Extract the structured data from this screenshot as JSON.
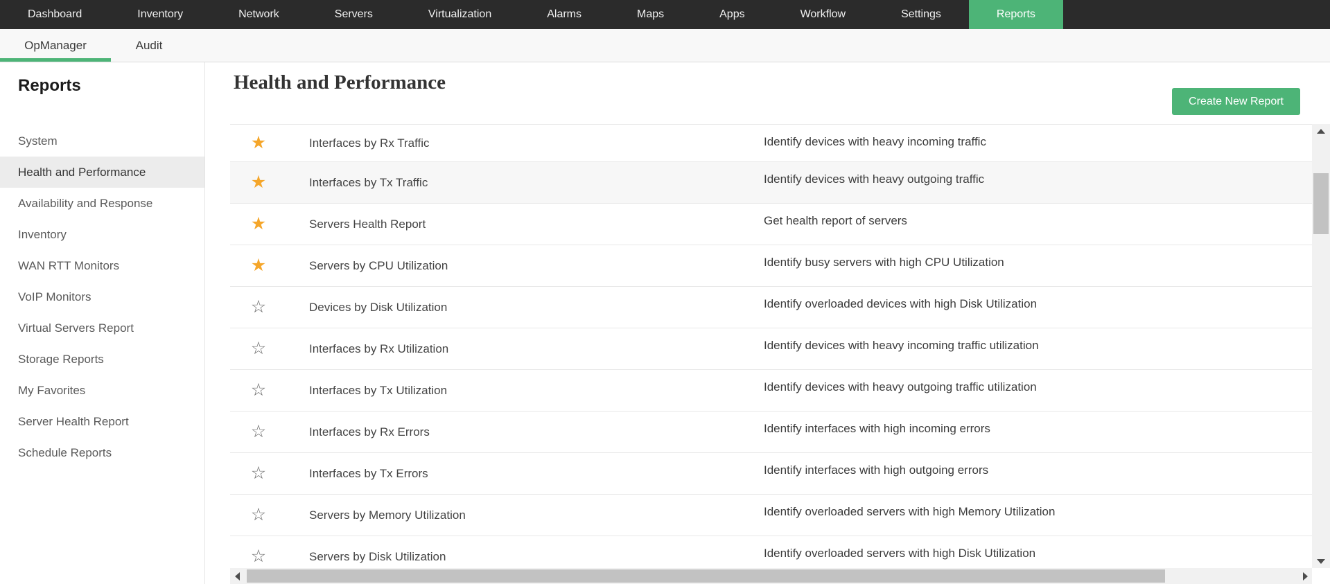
{
  "colors": {
    "accent_green": "#4db477",
    "nav_background": "#2b2b2b",
    "star_orange": "#f5a62a",
    "active_sidebar_bg": "#ececec"
  },
  "topnav": {
    "items": [
      {
        "label": "Dashboard",
        "active": false
      },
      {
        "label": "Inventory",
        "active": false
      },
      {
        "label": "Network",
        "active": false
      },
      {
        "label": "Servers",
        "active": false
      },
      {
        "label": "Virtualization",
        "active": false
      },
      {
        "label": "Alarms",
        "active": false
      },
      {
        "label": "Maps",
        "active": false
      },
      {
        "label": "Apps",
        "active": false
      },
      {
        "label": "Workflow",
        "active": false
      },
      {
        "label": "Settings",
        "active": false
      },
      {
        "label": "Reports",
        "active": true
      }
    ]
  },
  "subnav": {
    "tabs": [
      {
        "label": "OpManager",
        "active": true
      },
      {
        "label": "Audit",
        "active": false
      }
    ]
  },
  "sidebar": {
    "title": "Reports",
    "items": [
      {
        "label": "System",
        "active": false
      },
      {
        "label": "Health and Performance",
        "active": true
      },
      {
        "label": "Availability and Response",
        "active": false
      },
      {
        "label": "Inventory",
        "active": false
      },
      {
        "label": "WAN RTT Monitors",
        "active": false
      },
      {
        "label": "VoIP Monitors",
        "active": false
      },
      {
        "label": "Virtual Servers Report",
        "active": false
      },
      {
        "label": "Storage Reports",
        "active": false
      },
      {
        "label": "My Favorites",
        "active": false
      },
      {
        "label": "Server Health Report",
        "active": false
      },
      {
        "label": "Schedule Reports",
        "active": false
      }
    ]
  },
  "main": {
    "title": "Health and Performance",
    "create_button_label": "Create New Report",
    "hovered_row_index": 1,
    "reports": [
      {
        "starred": true,
        "name": "Interfaces by Rx Traffic",
        "description": "Identify devices with heavy incoming traffic"
      },
      {
        "starred": true,
        "name": "Interfaces by Tx Traffic",
        "description": "Identify devices with heavy outgoing traffic"
      },
      {
        "starred": true,
        "name": "Servers Health Report",
        "description": "Get health report of servers"
      },
      {
        "starred": true,
        "name": "Servers by CPU Utilization",
        "description": "Identify busy servers with high CPU Utilization"
      },
      {
        "starred": false,
        "name": "Devices by Disk Utilization",
        "description": "Identify overloaded devices with high Disk Utilization"
      },
      {
        "starred": false,
        "name": "Interfaces by Rx Utilization",
        "description": "Identify devices with heavy incoming traffic utilization"
      },
      {
        "starred": false,
        "name": "Interfaces by Tx Utilization",
        "description": "Identify devices with heavy outgoing traffic utilization"
      },
      {
        "starred": false,
        "name": "Interfaces by Rx Errors",
        "description": "Identify interfaces with high incoming errors"
      },
      {
        "starred": false,
        "name": "Interfaces by Tx Errors",
        "description": "Identify interfaces with high outgoing errors"
      },
      {
        "starred": false,
        "name": "Servers by Memory Utilization",
        "description": "Identify overloaded servers with high Memory Utilization"
      },
      {
        "starred": false,
        "name": "Servers by Disk Utilization",
        "description": "Identify overloaded servers with high Disk Utilization"
      }
    ]
  }
}
